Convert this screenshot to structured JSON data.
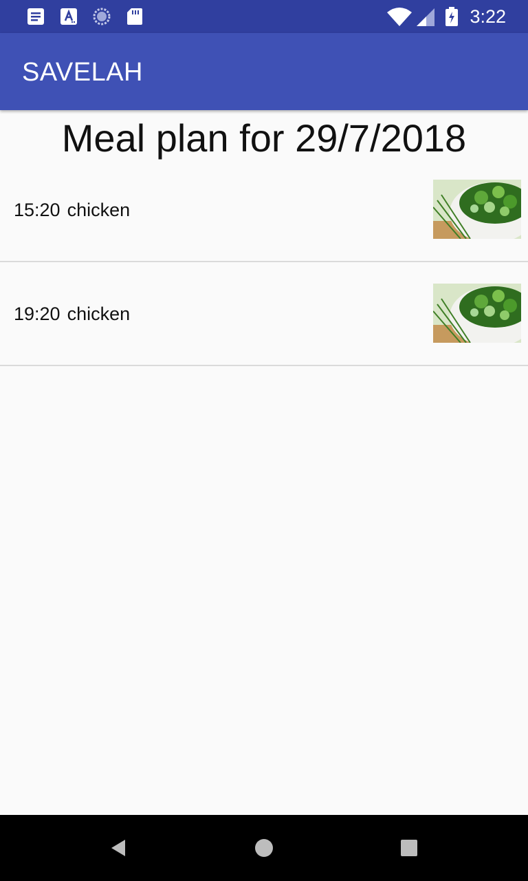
{
  "status_bar": {
    "time": "3:22",
    "left_icons": [
      "notes-icon",
      "text-a-icon",
      "sync-icon",
      "sd-card-icon"
    ],
    "right_icons": [
      "wifi-icon",
      "signal-icon",
      "battery-charging-icon"
    ]
  },
  "app_bar": {
    "title": "SAVELAH"
  },
  "main": {
    "heading": "Meal plan for 29/7/2018",
    "meals": [
      {
        "time": "15:20",
        "name": "chicken",
        "thumbnail": "salad-photo"
      },
      {
        "time": "19:20",
        "name": "chicken",
        "thumbnail": "salad-photo"
      }
    ]
  },
  "nav_bar": {
    "buttons": [
      "back-icon",
      "home-icon",
      "recents-icon"
    ]
  },
  "colors": {
    "status_bar": "#303f9f",
    "app_bar": "#3f51b5",
    "background": "#fafafa",
    "divider": "#dadada",
    "nav_bar": "#000000"
  }
}
